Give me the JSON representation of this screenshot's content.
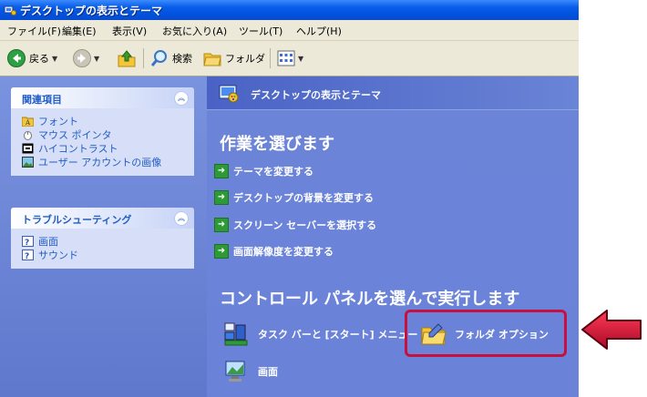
{
  "window": {
    "title": "デスクトップの表示とテーマ"
  },
  "menu": [
    "ファイル(F)",
    "編集(E)",
    "表示(V)",
    "お気に入り(A)",
    "ツール(T)",
    "ヘルプ(H)"
  ],
  "toolbar": {
    "back_label": "戻る",
    "search_label": "検索",
    "folders_label": "フォルダ"
  },
  "left": {
    "related": {
      "title": "関連項目",
      "items": [
        "フォント",
        "マウス ポインタ",
        "ハイコントラスト",
        "ユーザー アカウントの画像"
      ]
    },
    "troubleshoot": {
      "title": "トラブルシューティング",
      "items": [
        "画面",
        "サウンド"
      ]
    }
  },
  "content": {
    "header": "デスクトップの表示とテーマ",
    "pick_task": "作業を選びます",
    "tasks": [
      "テーマを変更する",
      "デスクトップの背景を変更する",
      "スクリーン セーバーを選択する",
      "画面解像度を変更する"
    ],
    "pick_icon": "コントロール パネルを選んで実行します",
    "icons": [
      "タスク バーと [スタート] メニュー",
      "フォルダ オプション",
      "画面"
    ]
  },
  "colors": {
    "highlight": "#c8103f",
    "panel_text": "#215dc6",
    "content_bg": "#6b84d9"
  }
}
